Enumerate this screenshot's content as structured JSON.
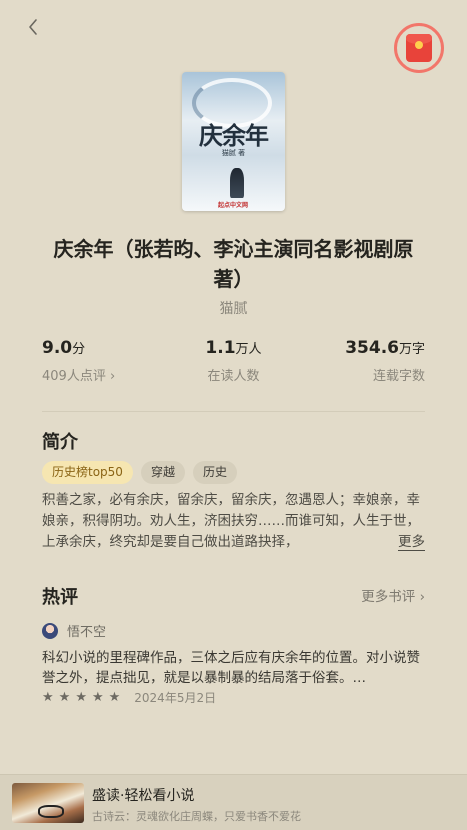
{
  "nav": {
    "back_icon": "chevron-left-icon",
    "reward_icon": "red-packet-icon"
  },
  "book": {
    "cover_title": "庆余年",
    "cover_author": "猫腻 著",
    "cover_publisher": "起点中文网",
    "title": "庆余年（张若昀、李沁主演同名影视剧原著）",
    "author": "猫腻"
  },
  "stats": {
    "score": {
      "value": "9.0",
      "unit": "分",
      "label": "409人点评 ›"
    },
    "readers": {
      "value": "1.1",
      "unit": "万人",
      "label": "在读人数"
    },
    "words": {
      "value": "354.6",
      "unit": "万字",
      "label": "连载字数"
    }
  },
  "intro": {
    "heading": "简介",
    "tags": [
      "历史榜top50",
      "穿越",
      "历史"
    ],
    "text": "积善之家，必有余庆，留余庆，留余庆，忽遇恩人；幸娘亲，幸娘亲，积得阴功。劝人生，济困扶穷……而谁可知，人生于世，上承余庆，终究却是要自己做出道路抉择，",
    "more": "更多"
  },
  "comments": {
    "heading": "热评",
    "more": "更多书评 ›",
    "items": [
      {
        "user": "悟不空",
        "text": "科幻小说的里程碑作品，三体之后应有庆余年的位置。对小说赞誉之外，提点拙见，就是以暴制暴的结局落于俗套。…",
        "stars": 5,
        "date": "2024年5月2日"
      }
    ]
  },
  "footer": {
    "title": "盛读·轻松看小说",
    "subtitle": "古诗云：灵魂欲化庄周蝶，只爱书香不爱花"
  }
}
